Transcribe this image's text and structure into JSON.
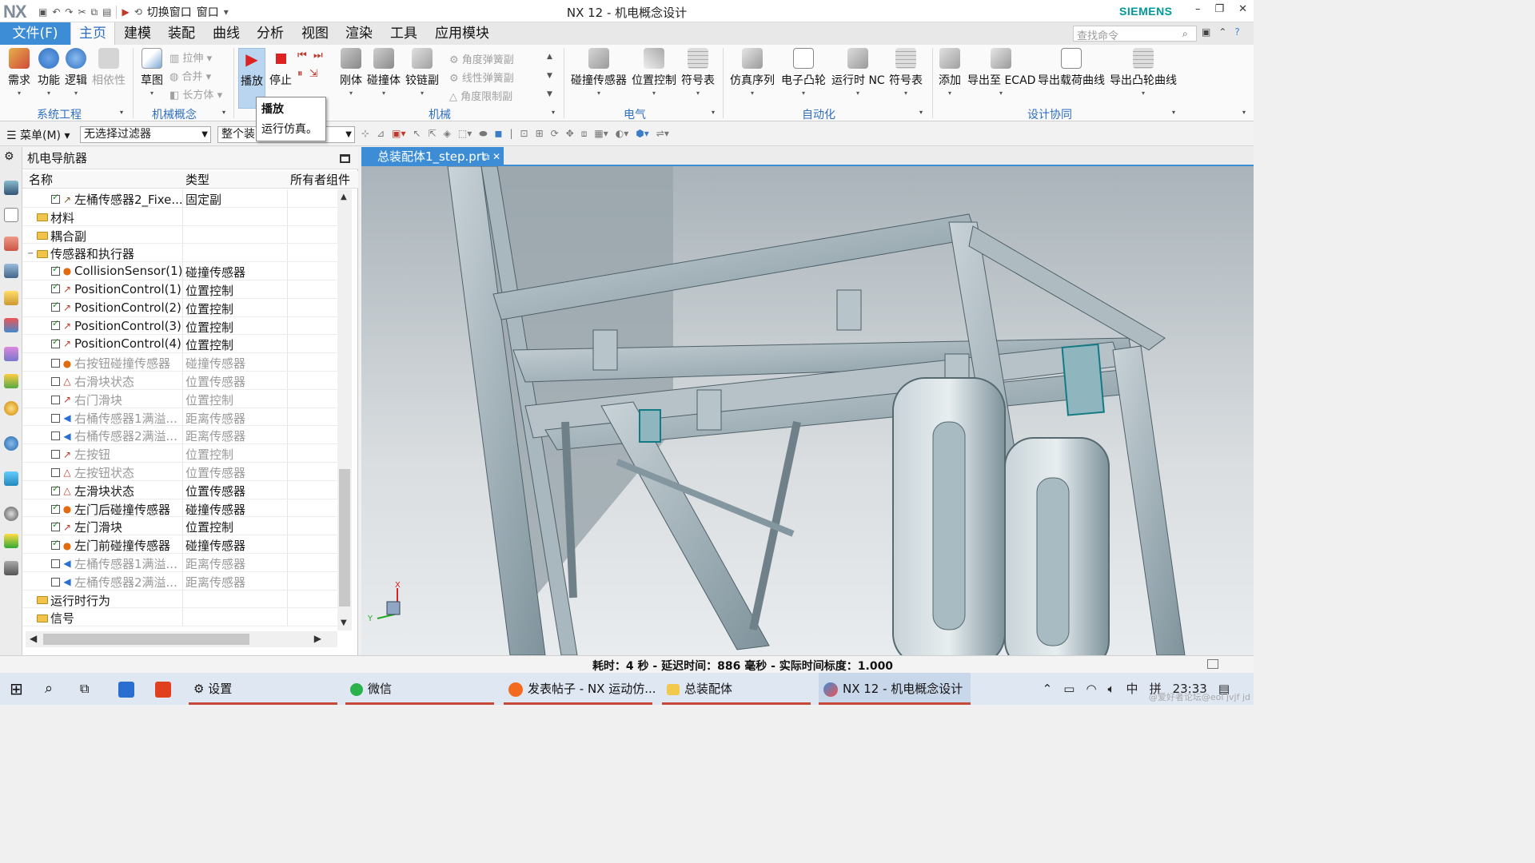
{
  "app": {
    "logo": "NX",
    "window_title": "NX 12 - 机电概念设计",
    "brand": "SIEMENS",
    "quick_access": {
      "switch_window": "切换窗口",
      "window": "窗口"
    },
    "window_buttons": {
      "minimize": "–",
      "restore": "❐",
      "close": "✕"
    }
  },
  "tabs": {
    "file": "文件(F)",
    "items": [
      "主页",
      "建模",
      "装配",
      "曲线",
      "分析",
      "视图",
      "渲染",
      "工具",
      "应用模块"
    ],
    "active": "主页",
    "search_placeholder": "查找命令"
  },
  "ribbon": {
    "system_engineering": {
      "label": "系统工程",
      "buttons": [
        "需求",
        "功能",
        "逻辑",
        "相依性"
      ]
    },
    "mech_concept": {
      "label": "机械概念",
      "sketch": "草图",
      "small": [
        "拉伸",
        "合并",
        "长方体"
      ]
    },
    "simulate": {
      "play": "播放",
      "stop": "停止"
    },
    "mechanical": {
      "label": "机械",
      "buttons": [
        "刚体",
        "碰撞体",
        "铰链副"
      ],
      "small": [
        "角度弹簧副",
        "线性弹簧副",
        "角度限制副"
      ]
    },
    "electrical": {
      "label": "电气",
      "buttons": [
        "碰撞传感器",
        "位置控制",
        "符号表"
      ]
    },
    "automation": {
      "label": "自动化",
      "buttons": [
        "仿真序列",
        "电子凸轮",
        "运行时 NC",
        "符号表"
      ]
    },
    "collaboration": {
      "label": "设计协同",
      "buttons": [
        "添加",
        "导出至 ECAD",
        "导出载荷曲线",
        "导出凸轮曲线"
      ]
    }
  },
  "tooltip": {
    "title": "播放",
    "body": "运行仿真。"
  },
  "toolbar": {
    "menu": "菜单(M)",
    "filter": "无选择过滤器",
    "scope": "整个装"
  },
  "navigator": {
    "title": "机电导航器",
    "columns": [
      "名称",
      "类型",
      "所有者组件"
    ],
    "rows": [
      {
        "indent": 2,
        "check": true,
        "icon": "fixed-joint",
        "name": "左桶传感器2_Fixe...",
        "type": "固定副",
        "enabled": true
      },
      {
        "indent": 1,
        "folder": true,
        "name": "材料",
        "type": "",
        "enabled": true
      },
      {
        "indent": 1,
        "folder": true,
        "name": "耦合副",
        "type": "",
        "enabled": true
      },
      {
        "indent": 0,
        "folder": true,
        "expanded": true,
        "name": "传感器和执行器",
        "type": "",
        "enabled": true
      },
      {
        "indent": 2,
        "check": true,
        "icon": "collision",
        "name": "CollisionSensor(1)",
        "type": "碰撞传感器",
        "enabled": true
      },
      {
        "indent": 2,
        "check": true,
        "icon": "position",
        "name": "PositionControl(1)",
        "type": "位置控制",
        "enabled": true
      },
      {
        "indent": 2,
        "check": true,
        "icon": "position",
        "name": "PositionControl(2)",
        "type": "位置控制",
        "enabled": true
      },
      {
        "indent": 2,
        "check": true,
        "icon": "position",
        "name": "PositionControl(3)",
        "type": "位置控制",
        "enabled": true
      },
      {
        "indent": 2,
        "check": true,
        "icon": "position",
        "name": "PositionControl(4)",
        "type": "位置控制",
        "enabled": true
      },
      {
        "indent": 2,
        "check": false,
        "icon": "collision",
        "name": "右按钮碰撞传感器",
        "type": "碰撞传感器",
        "enabled": false
      },
      {
        "indent": 2,
        "check": false,
        "icon": "sensor",
        "name": "右滑块状态",
        "type": "位置传感器",
        "enabled": false
      },
      {
        "indent": 2,
        "check": false,
        "icon": "position",
        "name": "右门滑块",
        "type": "位置控制",
        "enabled": false
      },
      {
        "indent": 2,
        "check": false,
        "icon": "distance",
        "name": "右桶传感器1满溢...",
        "type": "距离传感器",
        "enabled": false
      },
      {
        "indent": 2,
        "check": false,
        "icon": "distance",
        "name": "右桶传感器2满溢...",
        "type": "距离传感器",
        "enabled": false
      },
      {
        "indent": 2,
        "check": false,
        "icon": "position",
        "name": "左按钮",
        "type": "位置控制",
        "enabled": false
      },
      {
        "indent": 2,
        "check": false,
        "icon": "sensor",
        "name": "左按钮状态",
        "type": "位置传感器",
        "enabled": false
      },
      {
        "indent": 2,
        "check": true,
        "icon": "sensor",
        "name": "左滑块状态",
        "type": "位置传感器",
        "enabled": true
      },
      {
        "indent": 2,
        "check": true,
        "icon": "collision",
        "name": "左门后碰撞传感器",
        "type": "碰撞传感器",
        "enabled": true
      },
      {
        "indent": 2,
        "check": true,
        "icon": "position",
        "name": "左门滑块",
        "type": "位置控制",
        "enabled": true
      },
      {
        "indent": 2,
        "check": true,
        "icon": "collision",
        "name": "左门前碰撞传感器",
        "type": "碰撞传感器",
        "enabled": true
      },
      {
        "indent": 2,
        "check": false,
        "icon": "distance",
        "name": "左桶传感器1满溢...",
        "type": "距离传感器",
        "enabled": false
      },
      {
        "indent": 2,
        "check": false,
        "icon": "distance",
        "name": "左桶传感器2满溢...",
        "type": "距离传感器",
        "enabled": false
      },
      {
        "indent": 1,
        "folder": true,
        "name": "运行时行为",
        "type": "",
        "enabled": true
      },
      {
        "indent": 1,
        "folder": true,
        "name": "信号",
        "type": "",
        "enabled": true
      }
    ]
  },
  "viewport": {
    "tab_label": "总装配体1_step.prt",
    "axis_x": "X",
    "axis_y": "Y"
  },
  "status": {
    "message": "耗时：4 秒 - 延迟时间：886 毫秒 - 实际时间标度：1.000"
  },
  "taskbar": {
    "items": [
      "设置",
      "微信",
      "发表帖子 - NX 运动仿...",
      "总装配体",
      "NX 12 - 机电概念设计"
    ],
    "tray": {
      "ime": "中",
      "layout": "拼",
      "time": "23:33"
    },
    "watermark": "@爱好者论坛@eol jvjf jd"
  },
  "colors": {
    "accent": "#3d8cd6",
    "active_tab_text": "#2f6fc1",
    "brand": "#009999",
    "frame": "#9eb0ba"
  }
}
